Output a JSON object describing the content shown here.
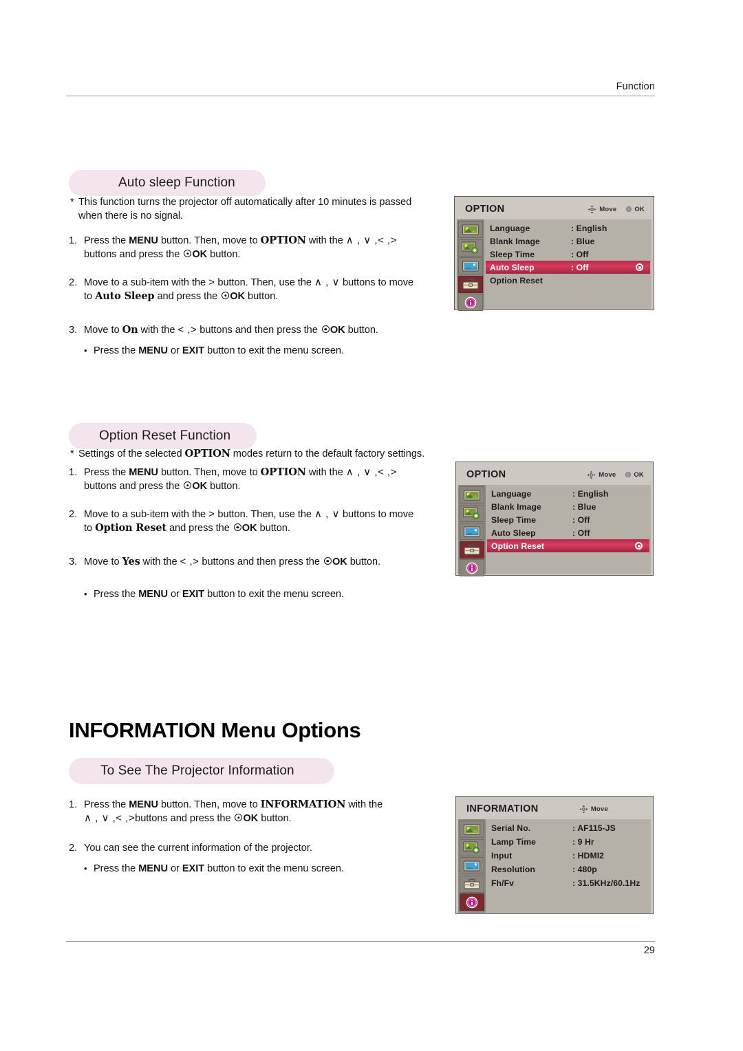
{
  "page": {
    "header_label": "Function",
    "page_number": "29"
  },
  "sections": [
    {
      "pill_title": "Auto sleep Function",
      "note": {
        "marker": "*",
        "line1": "This function turns the projector off automatically after 10 minutes is passed",
        "line2": "when there is no signal."
      },
      "steps": [
        {
          "num": "1.",
          "seg": [
            "Press the ",
            "MENU",
            " button. Then, move to ",
            "OPTION",
            " with the ",
            "∧ , ∨ ,< ,>",
            "buttons and press the ",
            "OK",
            " button."
          ]
        },
        {
          "num": "2.",
          "seg": [
            "Move to a sub-item with the ",
            ">",
            " button. Then, use the ",
            "∧ , ∨",
            " buttons to move",
            "to ",
            "Auto Sleep",
            " and press the ",
            "OK",
            " button."
          ]
        },
        {
          "num": "3.",
          "seg": [
            "Move to ",
            "On",
            " with the ",
            "< ,>",
            " buttons and then press the ",
            "OK",
            " button."
          ]
        }
      ],
      "bullet": {
        "marker": "•",
        "pre": "Press the ",
        "b1": "MENU",
        "mid": " or ",
        "b2": "EXIT",
        "post": " button to exit the menu screen."
      }
    },
    {
      "pill_title": "Option Reset Function",
      "note": {
        "marker": "*",
        "pre": "Settings of the selected ",
        "bold": "OPTION",
        "post": " modes return to the default factory settings."
      },
      "bullet": {
        "marker": "•",
        "pre": "Press the ",
        "b1": "MENU",
        "mid": " or ",
        "b2": "EXIT",
        "post": " button to exit the menu screen."
      }
    },
    {
      "heading": "INFORMATION Menu Options",
      "pill_title": "To See The Projector Information",
      "step2": "You can see the current information of the projector.",
      "bullet": {
        "marker": "•",
        "pre": "Press the ",
        "b1": "MENU",
        "mid": " or ",
        "b2": "EXIT",
        "post": " button to exit the menu screen."
      }
    }
  ],
  "osd_option_autosleep": {
    "title": "OPTION",
    "hint_move": "Move",
    "hint_ok": "OK",
    "rows": [
      {
        "label": "Language",
        "value": ": English",
        "selected": false
      },
      {
        "label": "Blank Image",
        "value": ": Blue",
        "selected": false
      },
      {
        "label": "Sleep Time",
        "value": ": Off",
        "selected": false
      },
      {
        "label": "Auto Sleep",
        "value": ": Off",
        "selected": true
      },
      {
        "label": "Option Reset",
        "value": "",
        "selected": false
      }
    ],
    "icons": [
      {
        "name": "picture-icon",
        "selected": false
      },
      {
        "name": "picture-plus-icon",
        "selected": false
      },
      {
        "name": "screen-blue-icon",
        "selected": false
      },
      {
        "name": "toolbox-icon",
        "selected": true
      },
      {
        "name": "information-icon",
        "selected": false
      }
    ]
  },
  "osd_option_reset": {
    "title": "OPTION",
    "hint_move": "Move",
    "hint_ok": "OK",
    "rows": [
      {
        "label": "Language",
        "value": ": English",
        "selected": false
      },
      {
        "label": "Blank Image",
        "value": ": Blue",
        "selected": false
      },
      {
        "label": "Sleep Time",
        "value": ": Off",
        "selected": false
      },
      {
        "label": "Auto Sleep",
        "value": ": Off",
        "selected": false
      },
      {
        "label": "Option Reset",
        "value": "",
        "selected": true
      }
    ],
    "icons": [
      {
        "name": "picture-icon",
        "selected": false
      },
      {
        "name": "picture-plus-icon",
        "selected": false
      },
      {
        "name": "screen-blue-icon",
        "selected": false
      },
      {
        "name": "toolbox-icon",
        "selected": true
      },
      {
        "name": "information-icon",
        "selected": false
      }
    ]
  },
  "osd_information": {
    "title": "INFORMATION",
    "hint_move": "Move",
    "rows": [
      {
        "label": "Serial No.",
        "value": ": AF115-JS"
      },
      {
        "label": "Lamp Time",
        "value": ":   9   Hr"
      },
      {
        "label": "Input",
        "value": ": HDMI2"
      },
      {
        "label": "Resolution",
        "value": ": 480p"
      },
      {
        "label": "Fh/Fv",
        "value": ": 31.5KHz/60.1Hz"
      }
    ],
    "icons": [
      {
        "name": "picture-icon",
        "selected": false
      },
      {
        "name": "picture-plus-icon",
        "selected": false
      },
      {
        "name": "screen-blue-icon",
        "selected": false
      },
      {
        "name": "toolbox-icon",
        "selected": false
      },
      {
        "name": "information-icon",
        "selected": true
      }
    ]
  },
  "colors": {
    "pill_bg": "#f3e4ee",
    "osd_bg": "#cdc9c2",
    "osd_rows_bg": "#b5b0a8",
    "highlight": "#c4354f",
    "icon_selected_bg": "#7a2b2f",
    "info_icon": "#c0208a"
  }
}
